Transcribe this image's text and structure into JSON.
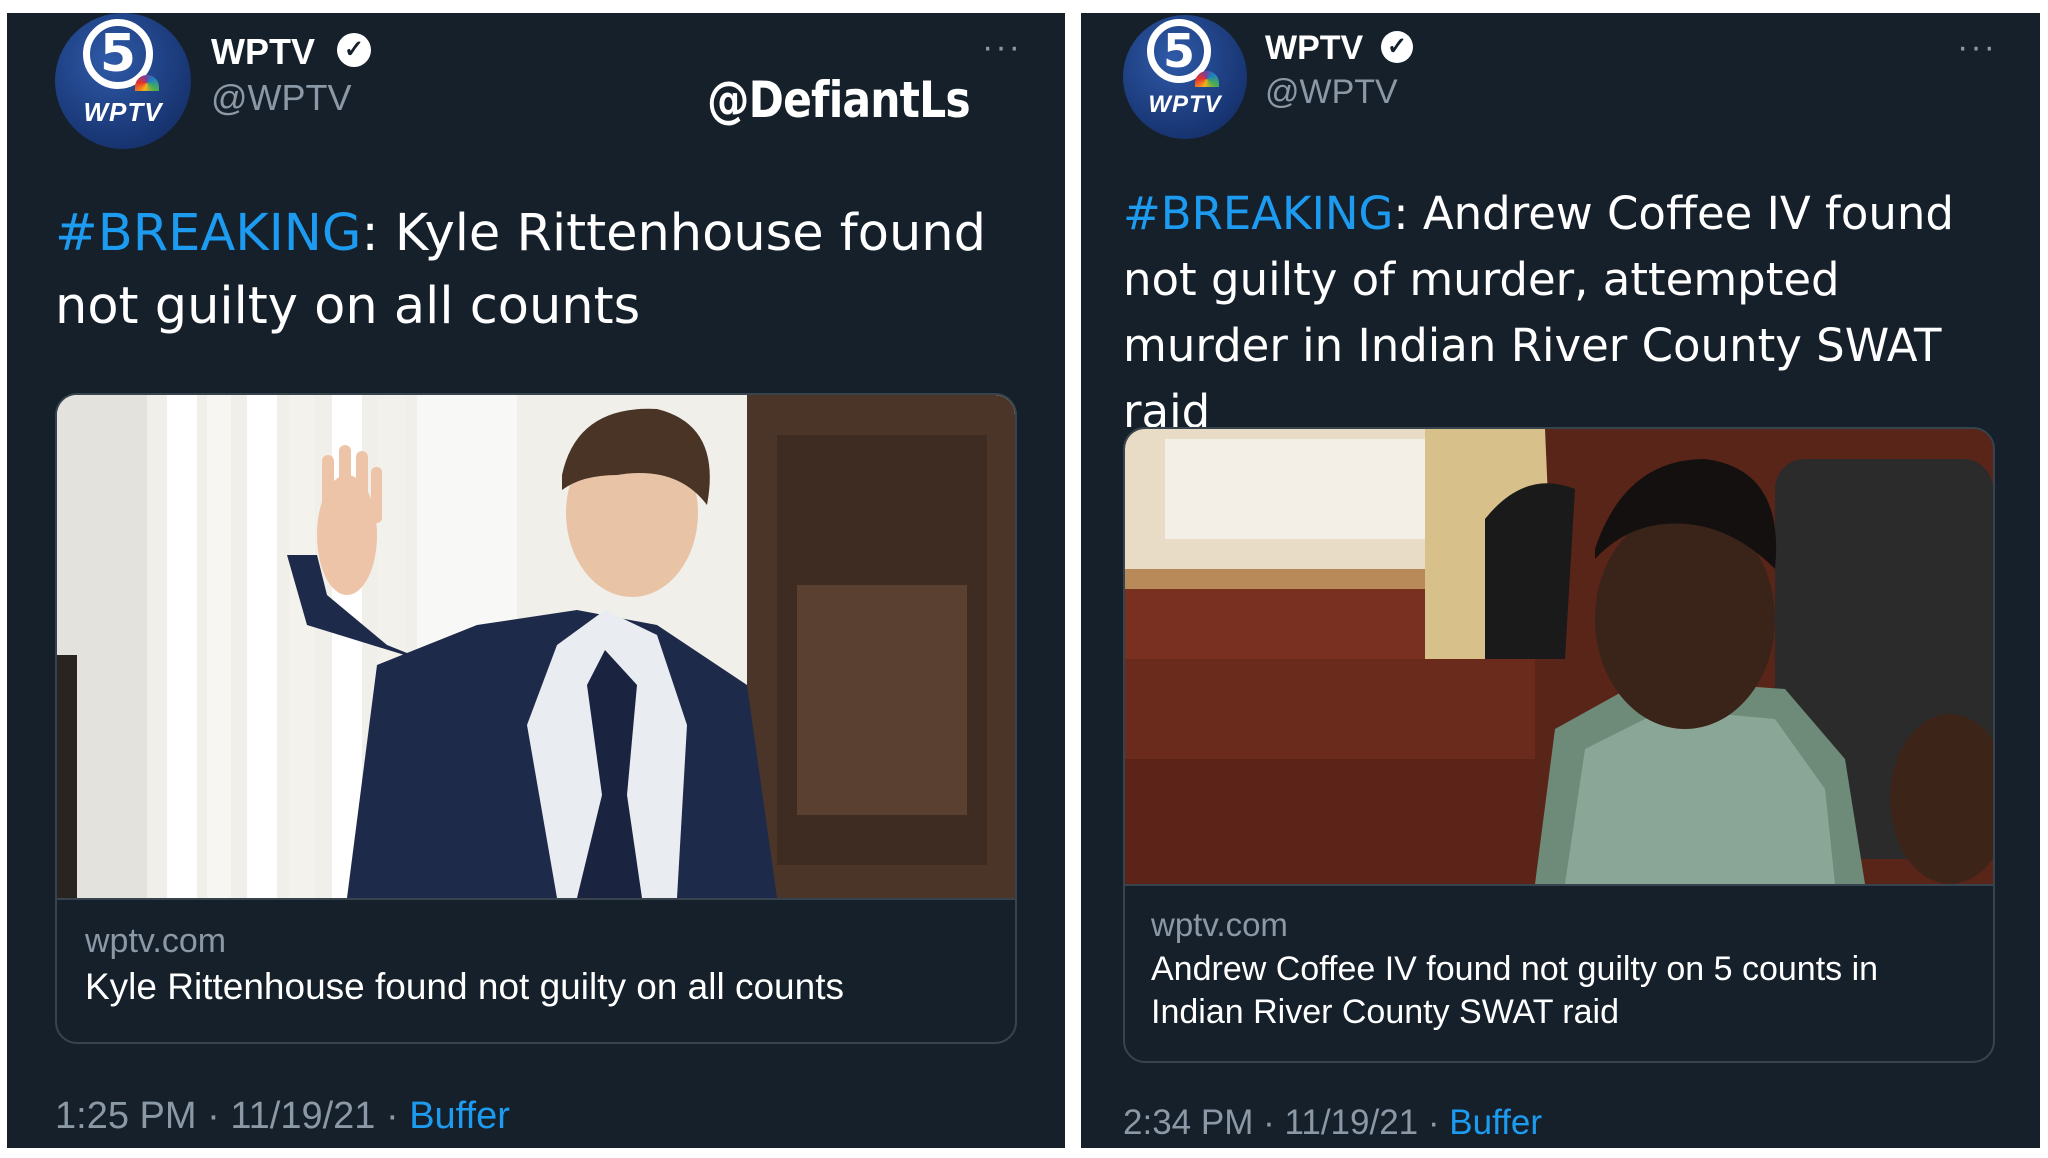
{
  "left_tweet": {
    "name": "WPTV",
    "handle": "@WPTV",
    "verified_icon": "verified-check-icon",
    "more_icon": "more-horizontal-icon",
    "watermark": "@DefiantLs",
    "text_hashtag": "#BREAKING",
    "text_body": ": Kyle Rittenhouse found not guilty on all counts",
    "card": {
      "domain": "wptv.com",
      "title": "Kyle Rittenhouse found not guilty on all counts"
    },
    "time": "1:25 PM",
    "date": "11/19/21",
    "separator": "·",
    "source": "Buffer"
  },
  "right_tweet": {
    "name": "WPTV",
    "handle": "@WPTV",
    "verified_icon": "verified-check-icon",
    "more_icon": "more-horizontal-icon",
    "text_hashtag": "#BREAKING",
    "text_body": ": Andrew Coffee IV found not guilty of murder, attempted murder in Indian River County SWAT raid",
    "card": {
      "domain": "wptv.com",
      "title": "Andrew Coffee IV found not guilty on 5 counts in Indian River County SWAT raid"
    },
    "time": "2:34 PM",
    "date": "11/19/21",
    "separator": "·",
    "source": "Buffer"
  },
  "avatar": {
    "number": "5",
    "wordmark": "WPTV"
  },
  "colors": {
    "background": "#15202b",
    "text": "#ffffff",
    "secondary": "#8b98a5",
    "link": "#1d9bf0",
    "border": "#38444d"
  }
}
